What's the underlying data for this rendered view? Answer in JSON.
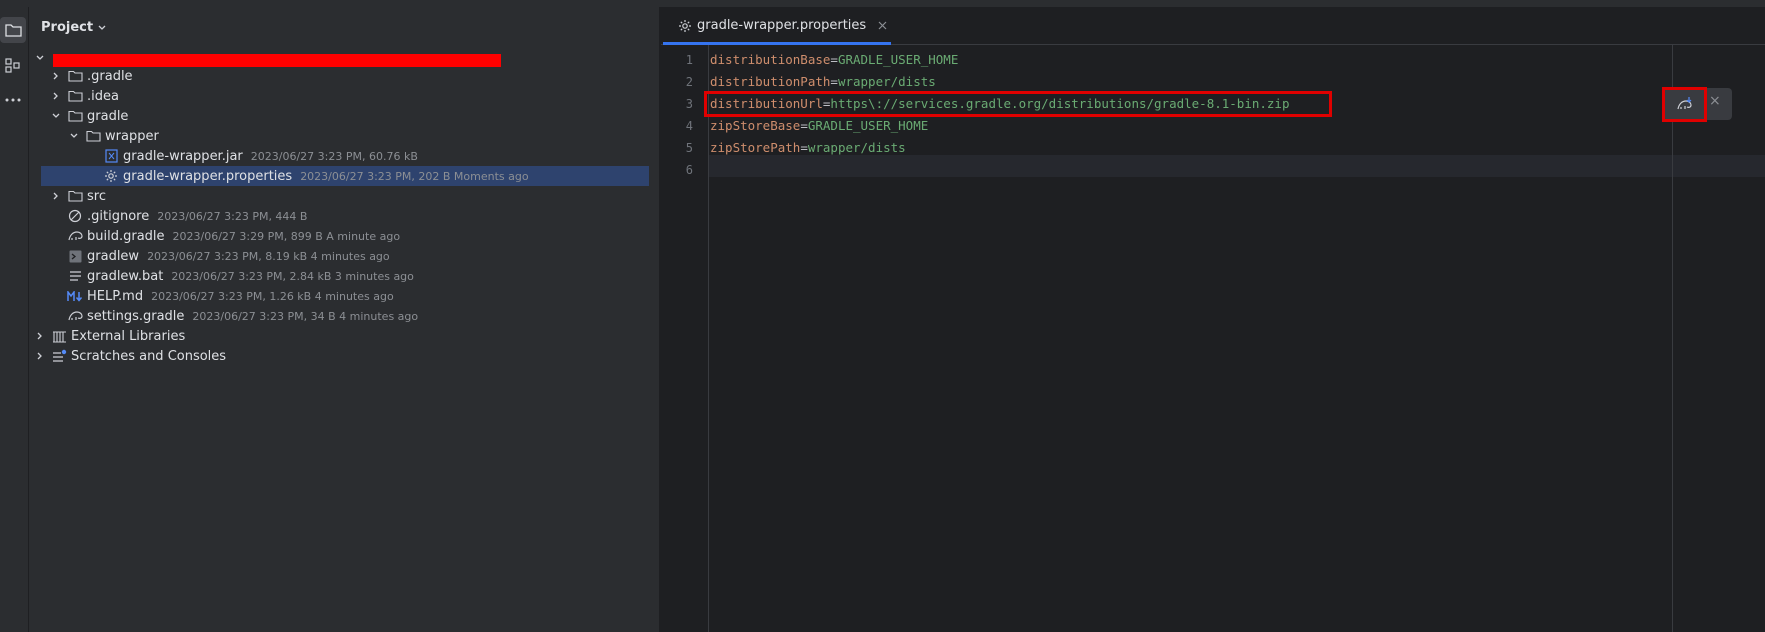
{
  "sidebar_icons": [
    "folder-icon",
    "structure-icon",
    "more-icon"
  ],
  "project_panel": {
    "title": "Project",
    "tree": [
      {
        "label": ".gradle",
        "meta": ""
      },
      {
        "label": ".idea",
        "meta": ""
      },
      {
        "label": "gradle",
        "meta": ""
      },
      {
        "label": "wrapper",
        "meta": ""
      },
      {
        "label": "gradle-wrapper.jar",
        "meta": "2023/06/27 3:23 PM, 60.76 kB"
      },
      {
        "label": "gradle-wrapper.properties",
        "meta": "2023/06/27 3:23 PM, 202 B Moments ago"
      },
      {
        "label": "src",
        "meta": ""
      },
      {
        "label": ".gitignore",
        "meta": "2023/06/27 3:23 PM, 444 B"
      },
      {
        "label": "build.gradle",
        "meta": "2023/06/27 3:29 PM, 899 B A minute ago"
      },
      {
        "label": "gradlew",
        "meta": "2023/06/27 3:23 PM, 8.19 kB 4 minutes ago"
      },
      {
        "label": "gradlew.bat",
        "meta": "2023/06/27 3:23 PM, 2.84 kB 3 minutes ago"
      },
      {
        "label": "HELP.md",
        "meta": "2023/06/27 3:23 PM, 1.26 kB 4 minutes ago"
      },
      {
        "label": "settings.gradle",
        "meta": "2023/06/27 3:23 PM, 34 B 4 minutes ago"
      },
      {
        "label": "External Libraries",
        "meta": ""
      },
      {
        "label": "Scratches and Consoles",
        "meta": ""
      }
    ]
  },
  "editor": {
    "tab_label": "gradle-wrapper.properties",
    "line_numbers": [
      "1",
      "2",
      "3",
      "4",
      "5",
      "6"
    ],
    "lines": [
      {
        "key": "distributionBase",
        "eq": "=",
        "value": "GRADLE_USER_HOME"
      },
      {
        "key": "distributionPath",
        "eq": "=",
        "value": "wrapper/dists"
      },
      {
        "key": "distributionUrl",
        "eq": "=",
        "value": "https\\://services.gradle.org/distributions/gradle-8.1-bin.zip"
      },
      {
        "key": "zipStoreBase",
        "eq": "=",
        "value": "GRADLE_USER_HOME"
      },
      {
        "key": "zipStorePath",
        "eq": "=",
        "value": "wrapper/dists"
      },
      {
        "key": "",
        "eq": "",
        "value": ""
      }
    ],
    "floating_toolbar": {
      "load_icon": "gradle-load-changes-icon",
      "close_symbol": "×"
    }
  },
  "colors": {
    "key": "#cf8e6d",
    "value": "#6aab73",
    "selection": "#2e436e",
    "highlight_box": "#e00000",
    "redaction": "#ff0000"
  }
}
